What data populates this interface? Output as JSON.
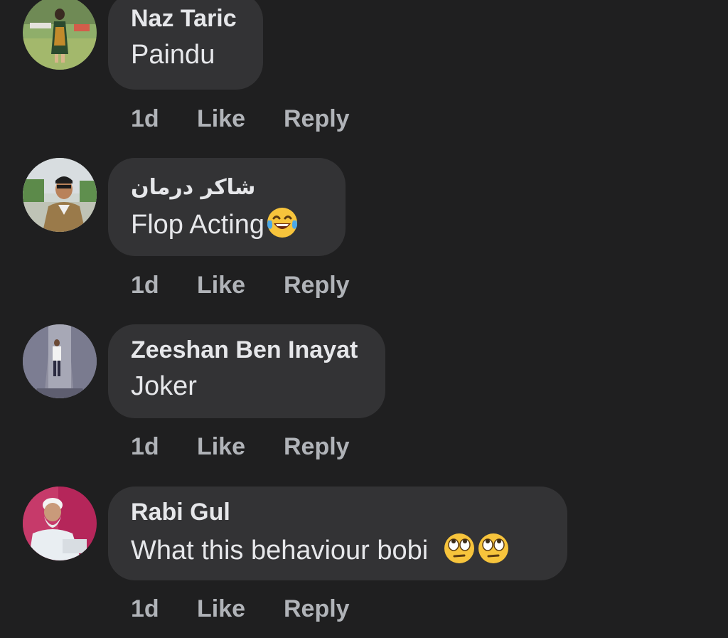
{
  "comments": [
    {
      "author": "Naz Taric",
      "text": "Paindu",
      "time": "1d",
      "like": "Like",
      "reply": "Reply",
      "emoji": []
    },
    {
      "author": "شاکر درمان",
      "text": "Flop Acting",
      "time": "1d",
      "like": "Like",
      "reply": "Reply",
      "emoji": [
        "tears-of-joy-emoji"
      ]
    },
    {
      "author": "Zeeshan Ben Inayat",
      "text": "Joker",
      "time": "1d",
      "like": "Like",
      "reply": "Reply",
      "emoji": []
    },
    {
      "author": "Rabi Gul",
      "text": "What this behaviour bobi",
      "time": "1d",
      "like": "Like",
      "reply": "Reply",
      "emoji": [
        "eye-roll-emoji",
        "eye-roll-emoji"
      ]
    }
  ],
  "colors": {
    "background": "#1f1f20",
    "bubble": "#333335",
    "text": "#e6e7ea",
    "muted": "#b0b3b8"
  }
}
